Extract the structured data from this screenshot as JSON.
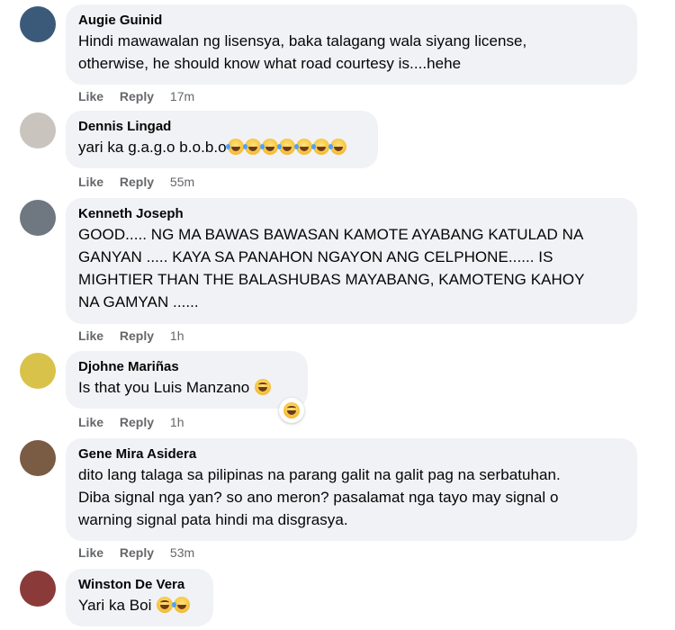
{
  "comments": [
    {
      "author": "Augie Guinid",
      "lines": [
        "Hindi mawawalan ng lisensya, baka talagang wala siyang license,",
        "otherwise, he should know what road courtesy is....hehe"
      ],
      "emojis": [],
      "like_label": "Like",
      "reply_label": "Reply",
      "time": "17m",
      "avatar_color": "#3b5a7a"
    },
    {
      "author": "Dennis Lingad",
      "lines": [
        "yari ka g.a.g.o b.o.b.o"
      ],
      "emojis": [
        "rolling-on-floor-laughing",
        "rolling-on-floor-laughing",
        "rolling-on-floor-laughing",
        "rolling-on-floor-laughing",
        "rolling-on-floor-laughing",
        "rolling-on-floor-laughing",
        "rolling-on-floor-laughing"
      ],
      "like_label": "Like",
      "reply_label": "Reply",
      "time": "55m",
      "avatar_color": "#c9c4bd"
    },
    {
      "author": "Kenneth Joseph",
      "lines": [
        "GOOD..... NG MA BAWAS BAWASAN KAMOTE AYABANG KATULAD NA",
        "GANYAN ..... KAYA SA PANAHON NGAYON ANG CELPHONE...... IS",
        "MIGHTIER THAN THE BALASHUBAS MAYABANG, KAMOTENG KAHOY",
        "NA GAMYAN ......"
      ],
      "emojis": [],
      "like_label": "Like",
      "reply_label": "Reply",
      "time": "1h",
      "avatar_color": "#6f7780"
    },
    {
      "author": "Djohne Mariñas",
      "lines": [
        "Is that you Luis Manzano"
      ],
      "emojis": [
        "grinning-squinting-face"
      ],
      "like_label": "Like",
      "reply_label": "Reply",
      "time": "1h",
      "avatar_color": "#d9c24a",
      "reaction": "haha-reaction"
    },
    {
      "author": "Gene Mira Asidera",
      "lines": [
        "dito lang talaga sa pilipinas na parang galit na galit pag na serbatuhan.",
        "Diba signal nga yan? so ano meron? pasalamat nga tayo may signal o",
        "warning signal pata hindi ma disgrasya."
      ],
      "emojis": [],
      "like_label": "Like",
      "reply_label": "Reply",
      "time": "53m",
      "avatar_color": "#7a5b44"
    },
    {
      "author": "Winston De Vera",
      "lines": [
        "Yari ka Boi"
      ],
      "emojis": [
        "grimacing-face",
        "rolling-on-floor-laughing"
      ],
      "like_label": "Like",
      "reply_label": "Reply",
      "time": "",
      "avatar_color": "#8b3a3a"
    }
  ]
}
